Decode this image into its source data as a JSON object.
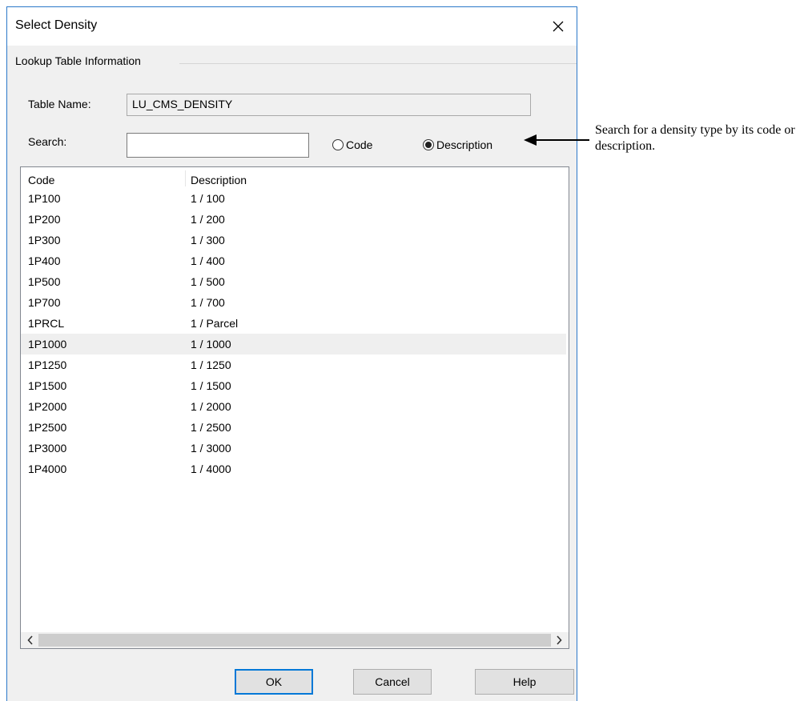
{
  "dialog": {
    "title": "Select Density",
    "group_label": "Lookup Table Information",
    "table_name_label": "Table Name:",
    "table_name_value": "LU_CMS_DENSITY",
    "search_label": "Search:",
    "search_value": "",
    "radio_code_label": "Code",
    "radio_description_label": "Description",
    "selected_radio": "Description"
  },
  "list": {
    "columns": [
      "Code",
      "Description"
    ],
    "rows": [
      {
        "code": "1P100",
        "description": "1 / 100"
      },
      {
        "code": "1P200",
        "description": "1 / 200"
      },
      {
        "code": "1P300",
        "description": "1 / 300"
      },
      {
        "code": "1P400",
        "description": "1 / 400"
      },
      {
        "code": "1P500",
        "description": "1 / 500"
      },
      {
        "code": "1P700",
        "description": "1 / 700"
      },
      {
        "code": "1PRCL",
        "description": "1 / Parcel"
      },
      {
        "code": "1P1000",
        "description": "1 / 1000"
      },
      {
        "code": "1P1250",
        "description": "1 / 1250"
      },
      {
        "code": "1P1500",
        "description": "1 / 1500"
      },
      {
        "code": "1P2000",
        "description": "1 / 2000"
      },
      {
        "code": "1P2500",
        "description": "1 / 2500"
      },
      {
        "code": "1P3000",
        "description": "1 / 3000"
      },
      {
        "code": "1P4000",
        "description": "1 / 4000"
      }
    ],
    "highlighted_row_code": "1P1000"
  },
  "buttons": {
    "ok": "OK",
    "cancel": "Cancel",
    "help": "Help"
  },
  "annotation": {
    "text": "Search for a density type by its code or description."
  },
  "icons": {
    "close": "close-icon",
    "scroll_left": "chevron-left-icon",
    "scroll_right": "chevron-right-icon",
    "annotation_arrow": "arrow-left-icon"
  },
  "colors": {
    "dialog_border": "#2b78c9",
    "default_button_border": "#0078d7",
    "highlight_row": "#efefef"
  }
}
